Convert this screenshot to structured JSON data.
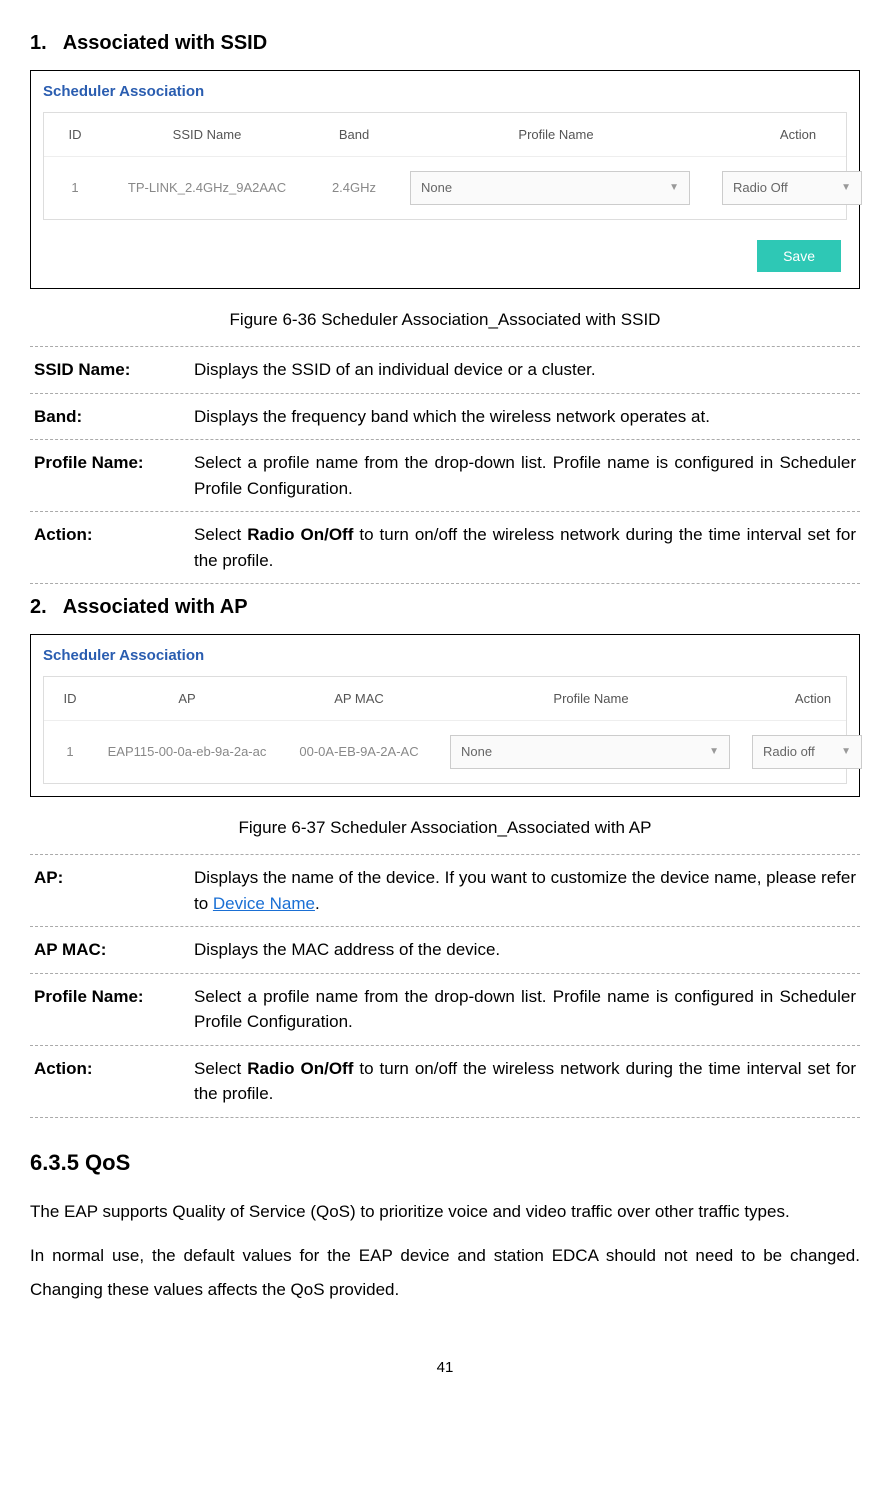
{
  "section1": {
    "number": "1.",
    "title": "Associated with SSID"
  },
  "fig1": {
    "panelTitle": "Scheduler Association",
    "headers": {
      "id": "ID",
      "ssid": "SSID Name",
      "band": "Band",
      "profile": "Profile Name",
      "action": "Action"
    },
    "row": {
      "id": "1",
      "ssid": "TP-LINK_2.4GHz_9A2AAC",
      "band": "2.4GHz",
      "profile": "None",
      "action": "Radio Off"
    },
    "save": "Save",
    "caption": "Figure 6-36 Scheduler Association_Associated with SSID"
  },
  "defs1": {
    "ssidName": {
      "label": "SSID Name:",
      "desc": "Displays the SSID of an individual device or a cluster."
    },
    "band": {
      "label": "Band:",
      "desc": "Displays the frequency band which the wireless network operates at."
    },
    "profile": {
      "label": "Profile Name:",
      "desc": "Select a profile name from the drop-down list. Profile name is configured in Scheduler Profile Configuration."
    },
    "action": {
      "label": "Action:",
      "pre": "Select ",
      "bold": "Radio On/Off",
      "post": " to turn on/off the wireless network during the time interval set for the profile."
    }
  },
  "section2": {
    "number": "2.",
    "title": "Associated with AP"
  },
  "fig2": {
    "panelTitle": "Scheduler Association",
    "headers": {
      "id": "ID",
      "ap": "AP",
      "mac": "AP MAC",
      "profile": "Profile Name",
      "action": "Action"
    },
    "row": {
      "id": "1",
      "ap": "EAP115-00-0a-eb-9a-2a-ac",
      "mac": "00-0A-EB-9A-2A-AC",
      "profile": "None",
      "action": "Radio off"
    },
    "caption": "Figure 6-37 Scheduler Association_Associated with AP"
  },
  "defs2": {
    "ap": {
      "label": "AP:",
      "pre": "Displays the name of the device. If you want to customize the device name, please refer to ",
      "link": "Device Name",
      "post": "."
    },
    "mac": {
      "label": "AP MAC:",
      "desc": "Displays the MAC address of the device."
    },
    "profile": {
      "label": "Profile Name:",
      "desc": "Select a profile name from the drop-down list. Profile name is configured in Scheduler Profile Configuration."
    },
    "action": {
      "label": "Action:",
      "pre": "Select ",
      "bold": "Radio On/Off",
      "post": " to turn on/off the wireless network during the time interval set for the profile."
    }
  },
  "qos": {
    "heading": "6.3.5  QoS",
    "p1": "The EAP supports Quality of Service (QoS) to prioritize voice and video traffic over other traffic types.",
    "p2": "In normal use, the default values for the EAP device and station EDCA should not need to be changed. Changing these values affects the QoS provided."
  },
  "pageNumber": "41"
}
